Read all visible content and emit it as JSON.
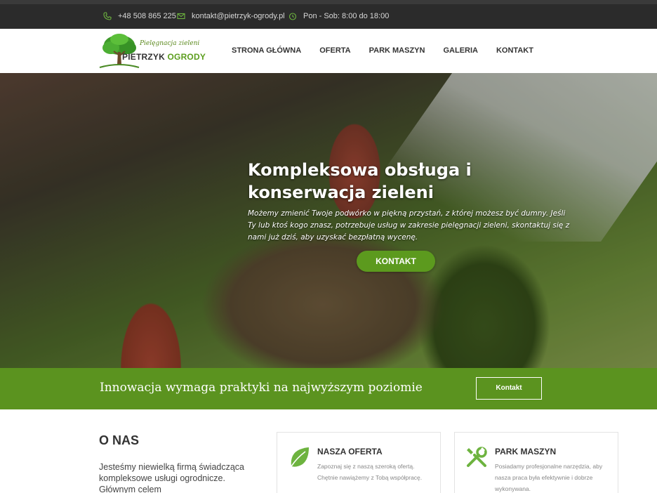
{
  "topbar": {
    "phone": "+48 508 865 225",
    "email": "kontakt@pietrzyk-ogrody.pl",
    "hours": "Pon - Sob: 8:00 do 18:00"
  },
  "logo": {
    "tagline": "Pielęgnacja zieleni",
    "brand_first": "PIETRZYK",
    "brand_second": "OGRODY"
  },
  "nav": {
    "items": [
      "STRONA GŁÓWNA",
      "OFERTA",
      "PARK MASZYN",
      "GALERIA",
      "KONTAKT"
    ]
  },
  "hero": {
    "title": "Kompleksowa obsługa i konserwacja zieleni",
    "text": "Możemy zmienić Twoje podwórko w piękną przystań, z której możesz być dumny. Jeśli Ty lub ktoś kogo znasz, potrzebuje usług w zakresie pielęgnacji zieleni, skontaktuj się z nami już dziś, aby uzyskać bezpłatną wycenę.",
    "button": "KONTAKT"
  },
  "band": {
    "text": "Innowacja wymaga praktyki na najwyższym poziomie",
    "button": "Kontakt"
  },
  "about": {
    "title": "O NAS",
    "text": "Jesteśmy niewielką firmą świadcząca kompleksowe usługi ogrodnicze. Głównym celem"
  },
  "cards": [
    {
      "title": "NASZA OFERTA",
      "text": "Zapoznaj się z naszą szeroką ofertą. Chętnie nawiążemy z Tobą współpracę.",
      "icon": "leaf-icon"
    },
    {
      "title": "PARK MASZYN",
      "text": "Posiadamy profesjonalne narzędzia, aby nasza praca była efektywnie i dobrze wykonywana.",
      "icon": "tools-icon"
    }
  ],
  "colors": {
    "brand_green": "#5b931f",
    "topbar": "#2b2b2b",
    "icon_green": "#6db33f"
  }
}
